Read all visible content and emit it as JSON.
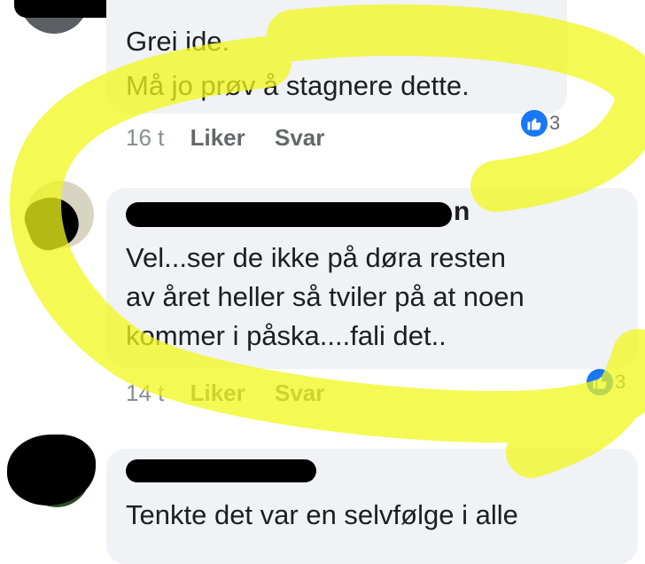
{
  "comments": [
    {
      "lines": [
        "Grei ide.",
        "Må jo prøv å stagnere dette."
      ],
      "time": "16 t",
      "like_label": "Liker",
      "reply_label": "Svar",
      "reaction_icon": "thumbs-up-icon",
      "reaction_count": "3"
    },
    {
      "author_suffix": "n",
      "lines": [
        "Vel...ser de ikke på døra resten",
        "av året heller så tviler på at noen",
        "kommer i påska....fali det.."
      ],
      "time": "14 t",
      "like_label": "Liker",
      "reply_label": "Svar",
      "reaction_icon": "thumbs-up-icon",
      "reaction_count": "3"
    },
    {
      "lines": [
        "Tenkte det var en selvfølge i alle"
      ]
    }
  ],
  "colors": {
    "bubble": "#f0f2f5",
    "text": "#1c1e21",
    "meta": "#8a8d91",
    "like_blue": "#1877f2",
    "highlight": "#f2f71a",
    "redaction": "#000000"
  }
}
